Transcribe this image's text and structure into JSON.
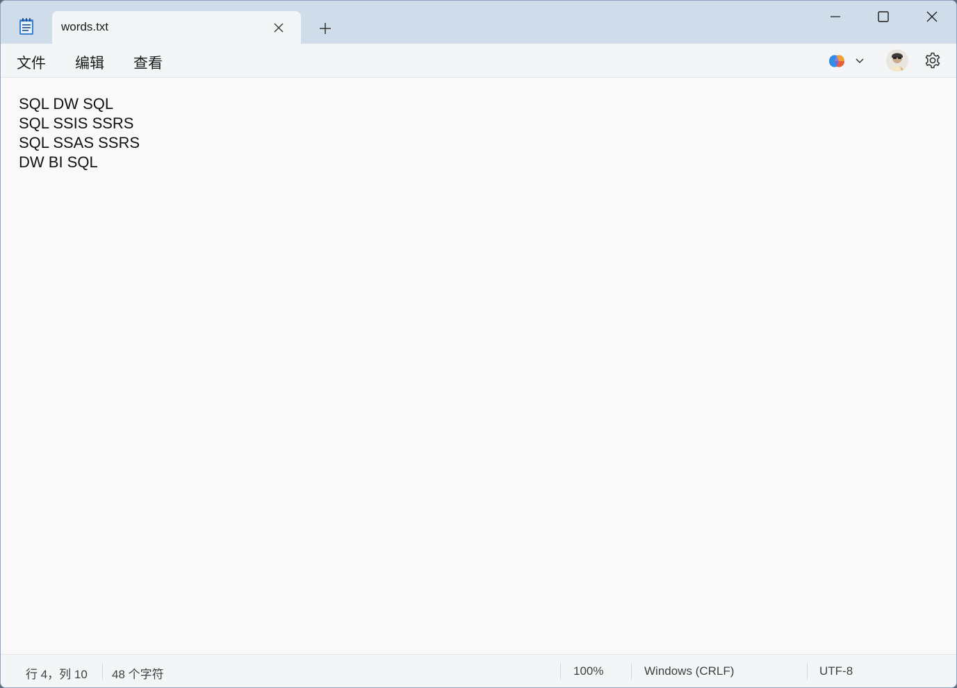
{
  "titlebar": {
    "tab_title": "words.txt",
    "new_tab_label": "+"
  },
  "menu": {
    "file": "文件",
    "edit": "编辑",
    "view": "查看"
  },
  "editor": {
    "lines": [
      "SQL DW SQL",
      "SQL SSIS SSRS",
      "SQL SSAS SSRS",
      "DW BI SQL"
    ]
  },
  "status": {
    "position": "行 4，列 10",
    "char_count": "48 个字符",
    "zoom": "100%",
    "line_ending": "Windows (CRLF)",
    "encoding": "UTF-8"
  },
  "icons": {
    "app": "notepad-icon",
    "tab_close": "close-icon",
    "minimize": "minimize-icon",
    "maximize": "maximize-icon",
    "close": "close-icon",
    "copilot": "copilot-icon",
    "dropdown": "chevron-down-icon",
    "account": "avatar",
    "settings": "gear-icon"
  },
  "colors": {
    "titlebar_bg": "#cfdcea",
    "tab_bg": "#f3f5f7",
    "editor_bg": "#f9f9f9"
  }
}
